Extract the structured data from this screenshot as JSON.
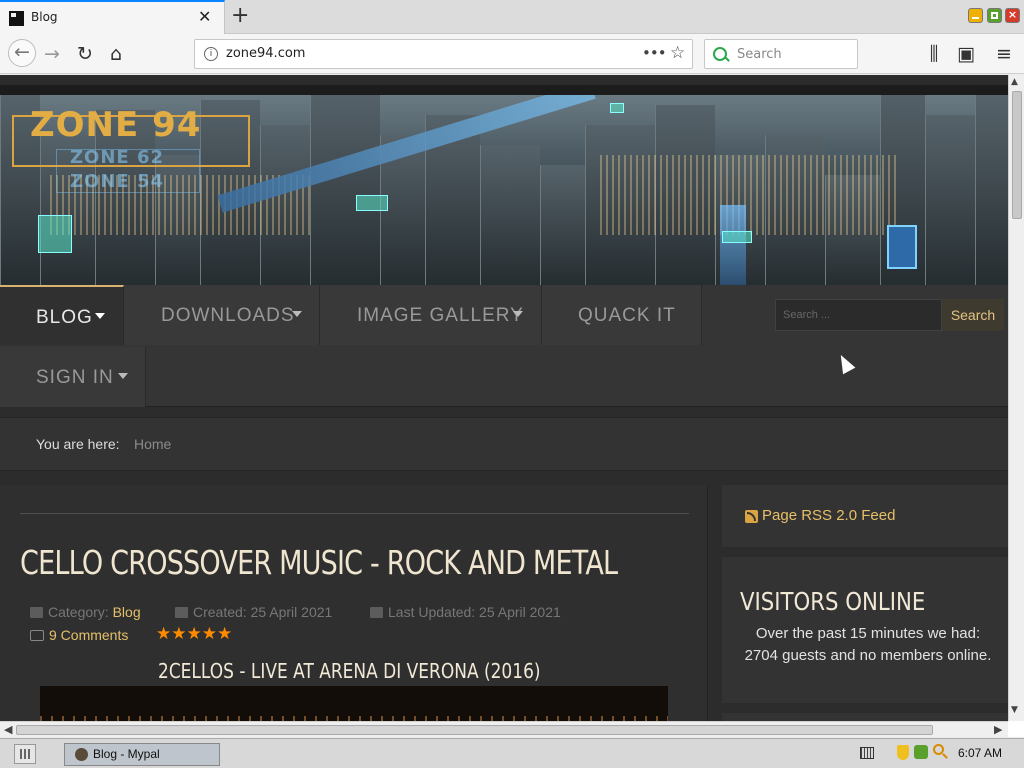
{
  "browser": {
    "tab_title": "Blog",
    "url": "zone94.com",
    "search_placeholder": "Search"
  },
  "site": {
    "logo_main": "ZONE 94",
    "logo_sub1": "ZONE 62",
    "logo_sub2": "ZONE 54",
    "nav": {
      "items": [
        {
          "label": "BLOG",
          "active": true,
          "has_dropdown": true
        },
        {
          "label": "DOWNLOADS",
          "active": false,
          "has_dropdown": true
        },
        {
          "label": "IMAGE GALLERY",
          "active": false,
          "has_dropdown": true
        },
        {
          "label": "QUACK IT",
          "active": false,
          "has_dropdown": false
        },
        {
          "label": "SIGN IN",
          "active": false,
          "has_dropdown": true
        }
      ],
      "search_placeholder": "Search ...",
      "search_button": "Search"
    },
    "breadcrumb": {
      "prefix": "You are here:",
      "home": "Home"
    }
  },
  "article": {
    "title": "CELLO CROSSOVER MUSIC - ROCK AND METAL",
    "category_prefix": "Category:",
    "category": "Blog",
    "created": "Created: 25 April 2021",
    "updated": "Last Updated: 25 April 2021",
    "comments": "9 Comments",
    "rating_stars": "★★★★★",
    "rating": 5,
    "video_title": "2CELLOS - LIVE AT ARENA DI VERONA (2016)"
  },
  "sidebar": {
    "rss_label": "Page RSS 2.0 Feed",
    "visitors_title": "VISITORS ONLINE",
    "visitors_text": "Over the past 15 minutes we had: 2704 guests and no members online."
  },
  "taskbar": {
    "window_label": "Blog - Mypal",
    "clock": "6:07 AM"
  },
  "colors": {
    "accent": "#e6c068",
    "page_bg": "#2c2c2c",
    "rating": "#ff8a00"
  }
}
